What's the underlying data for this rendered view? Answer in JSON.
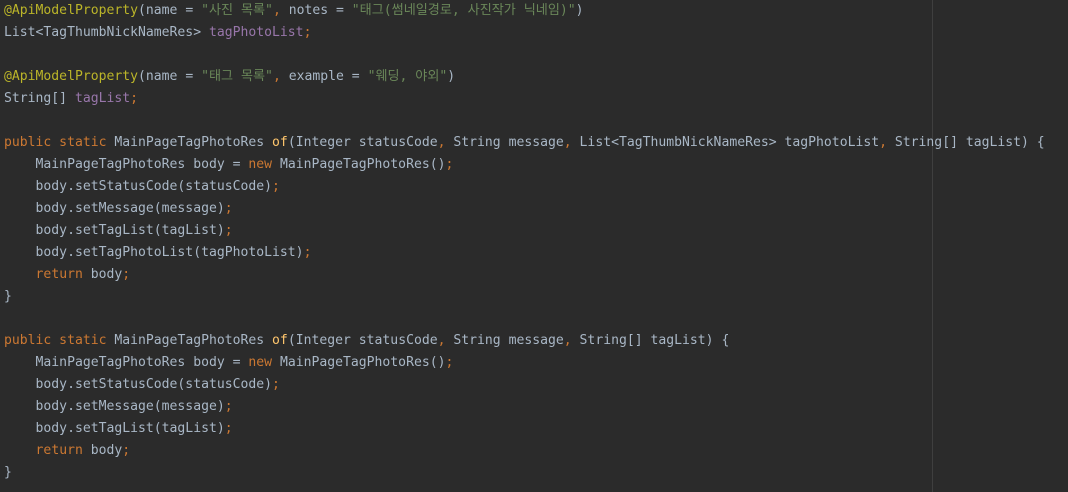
{
  "editor": {
    "colors": {
      "background": "#2b2b2b",
      "plain": "#a9b7c6",
      "annotation": "#bbb529",
      "keyword": "#cc7832",
      "string": "#6a8759",
      "field": "#9876aa",
      "method": "#ffc66d",
      "guide": "#3f3f3f"
    },
    "lines": [
      [
        {
          "t": "@ApiModelProperty",
          "c": "annotation"
        },
        {
          "t": "(name = ",
          "c": "plain"
        },
        {
          "t": "\"사진 목록\"",
          "c": "string"
        },
        {
          "t": ", ",
          "c": "punct"
        },
        {
          "t": "notes = ",
          "c": "plain"
        },
        {
          "t": "\"태그(썸네일경로, 사진작가 닉네임)\"",
          "c": "string"
        },
        {
          "t": ")",
          "c": "plain"
        }
      ],
      [
        {
          "t": "List<TagThumbNickNameRes> ",
          "c": "plain"
        },
        {
          "t": "tagPhotoList",
          "c": "field"
        },
        {
          "t": ";",
          "c": "punct"
        }
      ],
      [],
      [
        {
          "t": "@ApiModelProperty",
          "c": "annotation"
        },
        {
          "t": "(name = ",
          "c": "plain"
        },
        {
          "t": "\"태그 목록\"",
          "c": "string"
        },
        {
          "t": ", ",
          "c": "punct"
        },
        {
          "t": "example = ",
          "c": "plain"
        },
        {
          "t": "\"웨딩, 야외\"",
          "c": "string"
        },
        {
          "t": ")",
          "c": "plain"
        }
      ],
      [
        {
          "t": "String[] ",
          "c": "plain"
        },
        {
          "t": "tagList",
          "c": "field"
        },
        {
          "t": ";",
          "c": "punct"
        }
      ],
      [],
      [
        {
          "t": "public static ",
          "c": "keyword"
        },
        {
          "t": "MainPageTagPhotoRes ",
          "c": "plain"
        },
        {
          "t": "of",
          "c": "method"
        },
        {
          "t": "(Integer statusCode",
          "c": "plain"
        },
        {
          "t": ", ",
          "c": "punct"
        },
        {
          "t": "String message",
          "c": "plain"
        },
        {
          "t": ", ",
          "c": "punct"
        },
        {
          "t": "List<TagThumbNickNameRes> tagPhotoList",
          "c": "plain"
        },
        {
          "t": ", ",
          "c": "punct"
        },
        {
          "t": "String[] tagList) {",
          "c": "plain"
        }
      ],
      [
        {
          "t": "    MainPageTagPhotoRes body = ",
          "c": "plain"
        },
        {
          "t": "new ",
          "c": "keyword"
        },
        {
          "t": "MainPageTagPhotoRes()",
          "c": "plain"
        },
        {
          "t": ";",
          "c": "punct"
        }
      ],
      [
        {
          "t": "    body.setStatusCode(statusCode)",
          "c": "plain"
        },
        {
          "t": ";",
          "c": "punct"
        }
      ],
      [
        {
          "t": "    body.setMessage(message)",
          "c": "plain"
        },
        {
          "t": ";",
          "c": "punct"
        }
      ],
      [
        {
          "t": "    body.setTagList(tagList)",
          "c": "plain"
        },
        {
          "t": ";",
          "c": "punct"
        }
      ],
      [
        {
          "t": "    body.setTagPhotoList(tagPhotoList)",
          "c": "plain"
        },
        {
          "t": ";",
          "c": "punct"
        }
      ],
      [
        {
          "t": "    ",
          "c": "plain"
        },
        {
          "t": "return ",
          "c": "keyword"
        },
        {
          "t": "body",
          "c": "plain"
        },
        {
          "t": ";",
          "c": "punct"
        }
      ],
      [
        {
          "t": "}",
          "c": "plain"
        }
      ],
      [],
      [
        {
          "t": "public static ",
          "c": "keyword"
        },
        {
          "t": "MainPageTagPhotoRes ",
          "c": "plain"
        },
        {
          "t": "of",
          "c": "method"
        },
        {
          "t": "(Integer statusCode",
          "c": "plain"
        },
        {
          "t": ", ",
          "c": "punct"
        },
        {
          "t": "String message",
          "c": "plain"
        },
        {
          "t": ", ",
          "c": "punct"
        },
        {
          "t": "String[] tagList) {",
          "c": "plain"
        }
      ],
      [
        {
          "t": "    MainPageTagPhotoRes body = ",
          "c": "plain"
        },
        {
          "t": "new ",
          "c": "keyword"
        },
        {
          "t": "MainPageTagPhotoRes()",
          "c": "plain"
        },
        {
          "t": ";",
          "c": "punct"
        }
      ],
      [
        {
          "t": "    body.setStatusCode(statusCode)",
          "c": "plain"
        },
        {
          "t": ";",
          "c": "punct"
        }
      ],
      [
        {
          "t": "    body.setMessage(message)",
          "c": "plain"
        },
        {
          "t": ";",
          "c": "punct"
        }
      ],
      [
        {
          "t": "    body.setTagList(tagList)",
          "c": "plain"
        },
        {
          "t": ";",
          "c": "punct"
        }
      ],
      [
        {
          "t": "    ",
          "c": "plain"
        },
        {
          "t": "return ",
          "c": "keyword"
        },
        {
          "t": "body",
          "c": "plain"
        },
        {
          "t": ";",
          "c": "punct"
        }
      ],
      [
        {
          "t": "}",
          "c": "plain"
        }
      ]
    ]
  }
}
